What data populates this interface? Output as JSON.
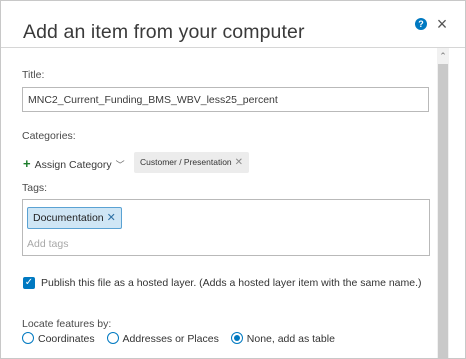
{
  "dialog": {
    "title": "Add an item from your computer",
    "help_icon": "?",
    "close_icon": "×"
  },
  "form": {
    "title_label": "Title:",
    "title_value": "MNC2_Current_Funding_BMS_WBV_less25_percent",
    "categories_label": "Categories:",
    "assign_category_label": "Assign Category",
    "categories": [
      {
        "label": "Customer / Presentation"
      }
    ],
    "tags_label": "Tags:",
    "tags": [
      {
        "label": "Documentation"
      }
    ],
    "tags_placeholder": "Add tags",
    "publish_checkbox_checked": true,
    "publish_label": "Publish this file as a hosted layer. (Adds a hosted layer item with the same name.)",
    "locate_label": "Locate features by:",
    "locate_options": [
      {
        "label": "Coordinates",
        "selected": false
      },
      {
        "label": "Addresses or Places",
        "selected": false
      },
      {
        "label": "None, add as table",
        "selected": true
      }
    ]
  },
  "colors": {
    "accent": "#0079c1",
    "tag_chip_bg": "#cfe6f5",
    "plus_icon": "#1c7d2b"
  }
}
